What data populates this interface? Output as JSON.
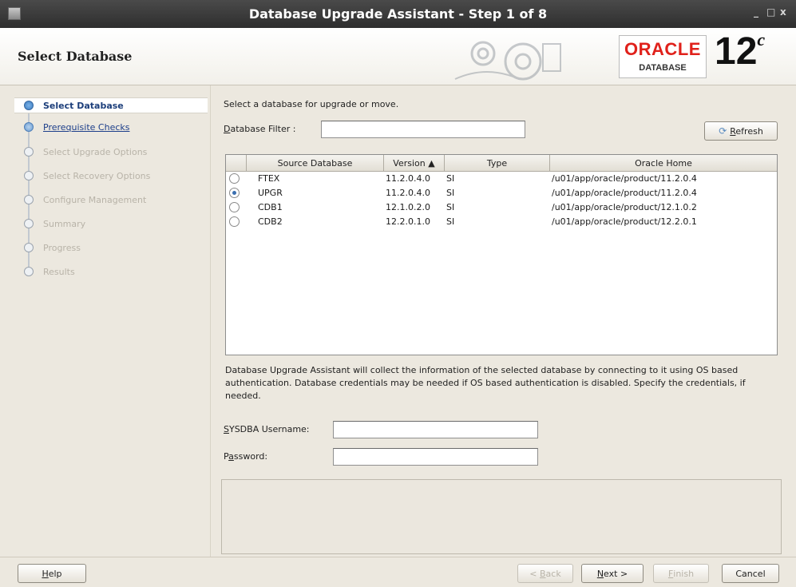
{
  "window": {
    "title": "Database Upgrade Assistant - Step 1 of 8",
    "controls": [
      "_",
      "□",
      "x"
    ]
  },
  "header": {
    "page_title": "Select Database",
    "brand_word": "ORACLE",
    "brand_sub": "DATABASE",
    "brand_version": "12",
    "brand_version_sup": "c"
  },
  "steps": [
    {
      "label": "Select Database",
      "state": "current"
    },
    {
      "label": "Prerequisite Checks",
      "state": "link"
    },
    {
      "label": "Select Upgrade Options",
      "state": "disabled"
    },
    {
      "label": "Select Recovery Options",
      "state": "disabled"
    },
    {
      "label": "Configure Management",
      "state": "disabled"
    },
    {
      "label": "Summary",
      "state": "disabled"
    },
    {
      "label": "Progress",
      "state": "disabled"
    },
    {
      "label": "Results",
      "state": "disabled"
    }
  ],
  "main": {
    "instruction": "Select a database for upgrade or move.",
    "filter_label_mn": "D",
    "filter_label_rest": "atabase Filter :",
    "filter_value": "",
    "refresh_label_mn": "R",
    "refresh_label_rest": "efresh",
    "columns": [
      "",
      "Source Database",
      "Version ▲",
      "Type",
      "Oracle Home"
    ],
    "rows": [
      {
        "selected": false,
        "source": "FTEX",
        "version": "11.2.0.4.0",
        "type": "SI",
        "home": "/u01/app/oracle/product/11.2.0.4"
      },
      {
        "selected": true,
        "source": "UPGR",
        "version": "11.2.0.4.0",
        "type": "SI",
        "home": "/u01/app/oracle/product/11.2.0.4"
      },
      {
        "selected": false,
        "source": "CDB1",
        "version": "12.1.0.2.0",
        "type": "SI",
        "home": "/u01/app/oracle/product/12.1.0.2"
      },
      {
        "selected": false,
        "source": "CDB2",
        "version": "12.2.0.1.0",
        "type": "SI",
        "home": "/u01/app/oracle/product/12.2.0.1"
      }
    ],
    "info_text": "Database Upgrade Assistant will collect the information of the selected database by connecting to it using OS based authentication. Database credentials may be needed if OS based authentication is disabled. Specify the credentials, if needed.",
    "sysdba_label_mn": "S",
    "sysdba_label_rest": "YSDBA Username:",
    "sysdba_value": "",
    "password_label_pre": "P",
    "password_label_mn": "a",
    "password_label_rest": "ssword:",
    "password_value": ""
  },
  "footer": {
    "help_mn": "H",
    "help_rest": "elp",
    "back_pre": "< ",
    "back_mn": "B",
    "back_rest": "ack",
    "next_mn": "N",
    "next_rest": "ext >",
    "finish_mn": "F",
    "finish_rest": "inish",
    "cancel": "Cancel"
  }
}
